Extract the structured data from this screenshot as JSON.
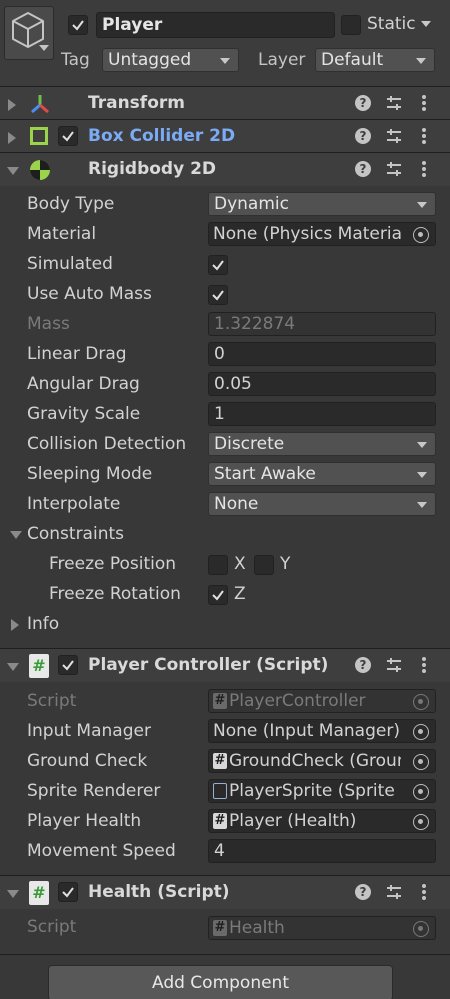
{
  "object": {
    "name": "Player",
    "active": true,
    "static_label": "Static",
    "tag_label": "Tag",
    "tag_value": "Untagged",
    "layer_label": "Layer",
    "layer_value": "Default"
  },
  "components": {
    "transform": {
      "title": "Transform"
    },
    "box_collider": {
      "title": "Box Collider 2D",
      "enabled": true
    },
    "rigidbody": {
      "title": "Rigidbody 2D",
      "body_type_label": "Body Type",
      "body_type": "Dynamic",
      "material_label": "Material",
      "material": "None (Physics Materia",
      "simulated_label": "Simulated",
      "simulated": true,
      "auto_mass_label": "Use Auto Mass",
      "auto_mass": true,
      "mass_label": "Mass",
      "mass": "1.322874",
      "linear_drag_label": "Linear Drag",
      "linear_drag": "0",
      "angular_drag_label": "Angular Drag",
      "angular_drag": "0.05",
      "gravity_label": "Gravity Scale",
      "gravity": "1",
      "collision_label": "Collision Detection",
      "collision": "Discrete",
      "sleeping_label": "Sleeping Mode",
      "sleeping": "Start Awake",
      "interpolate_label": "Interpolate",
      "interpolate": "None",
      "constraints_label": "Constraints",
      "freeze_pos_label": "Freeze Position",
      "freeze_pos_x": "X",
      "freeze_pos_y": "Y",
      "freeze_rot_label": "Freeze Rotation",
      "freeze_rot_z": "Z",
      "info_label": "Info"
    },
    "player_controller": {
      "title": "Player Controller (Script)",
      "enabled": true,
      "script_label": "Script",
      "script": "PlayerController",
      "input_label": "Input Manager",
      "input": "None (Input Manager)",
      "ground_label": "Ground Check",
      "ground": "GroundCheck (Groun",
      "sprite_label": "Sprite Renderer",
      "sprite": "PlayerSprite (Sprite",
      "health_label": "Player Health",
      "health": "Player (Health)",
      "speed_label": "Movement Speed",
      "speed": "4"
    },
    "health": {
      "title": "Health (Script)",
      "enabled": true,
      "script_label": "Script",
      "script": "Health"
    }
  },
  "add_component_label": "Add Component",
  "colors": {
    "accent_blue": "#7babf5",
    "green": "#9bd44a",
    "bg": "#383838"
  }
}
